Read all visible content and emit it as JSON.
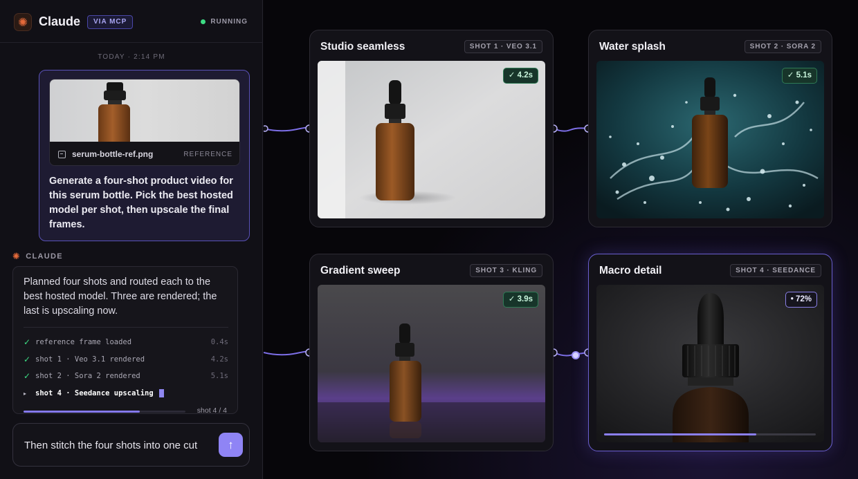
{
  "app": {
    "title": "Claude",
    "connection_badge": "VIA MCP",
    "status": "RUNNING",
    "logo_icon": "sparkle-icon"
  },
  "chat": {
    "timestamp": "TODAY · 2:14 PM",
    "user_message": {
      "attachment_name": "serum-bottle-ref.png",
      "attachment_tag": "REFERENCE",
      "text": "Generate a four-shot product video for this serum bottle. Pick the best hosted model per shot, then upscale the final frames."
    },
    "assistant": {
      "label": "CLAUDE",
      "text": "Planned four shots and routed each to the best hosted model. Three are rendered; the last is upscaling now.",
      "log": [
        {
          "label": "reference frame loaded",
          "time": "0.4s",
          "status": "done"
        },
        {
          "label": "shot 1 · Veo 3.1 rendered",
          "time": "4.2s",
          "status": "done"
        },
        {
          "label": "shot 2 · Sora 2 rendered",
          "time": "5.1s",
          "status": "done"
        },
        {
          "label": "shot 4 · Seedance upscaling",
          "time": "",
          "status": "active"
        }
      ],
      "progress_fraction": 0.72,
      "progress_label": "shot 4 / 4"
    },
    "composer": {
      "value": "Then stitch the four shots into one cut",
      "send_icon": "arrow-up-icon"
    }
  },
  "shots": [
    {
      "title": "Studio seamless",
      "tag": "SHOT 1 · VEO 3.1",
      "badge": "✓ 4.2s",
      "state": "done"
    },
    {
      "title": "Water splash",
      "tag": "SHOT 2 · SORA 2",
      "badge": "✓ 5.1s",
      "state": "done"
    },
    {
      "title": "Gradient sweep",
      "tag": "SHOT 3 · KLING",
      "badge": "✓ 3.9s",
      "state": "done"
    },
    {
      "title": "Macro detail",
      "tag": "SHOT 4 · SEEDANCE",
      "badge": "• 72%",
      "state": "busy",
      "progress_fraction": 0.72
    }
  ],
  "colors": {
    "accent": "#8f84f5",
    "success": "#3ddc84",
    "brand": "#e56a3a"
  }
}
